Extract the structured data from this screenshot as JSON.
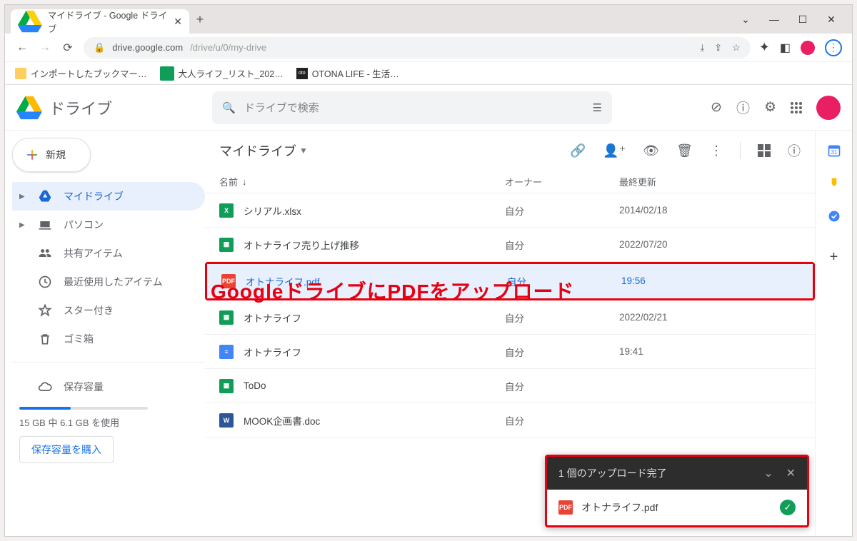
{
  "browser": {
    "tab_title": "マイドライブ - Google ドライブ",
    "url_host": "drive.google.com",
    "url_path": "/drive/u/0/my-drive",
    "bookmarks": [
      {
        "label": "インポートしたブックマー…",
        "type": "folder"
      },
      {
        "label": "大人ライフ_リスト_202…",
        "type": "sheet"
      },
      {
        "label": "OTONA LIFE - 生活…",
        "type": "site"
      }
    ]
  },
  "drive": {
    "app_name": "ドライブ",
    "search_placeholder": "ドライブで検索",
    "new_button": "新規",
    "sidebar": [
      {
        "key": "mydrive",
        "label": "マイドライブ",
        "icon": "drive",
        "chev": true,
        "active": true
      },
      {
        "key": "computers",
        "label": "パソコン",
        "icon": "devices",
        "chev": true
      },
      {
        "key": "shared",
        "label": "共有アイテム",
        "icon": "people"
      },
      {
        "key": "recent",
        "label": "最近使用したアイテム",
        "icon": "clock"
      },
      {
        "key": "starred",
        "label": "スター付き",
        "icon": "star"
      },
      {
        "key": "trash",
        "label": "ゴミ箱",
        "icon": "trash"
      }
    ],
    "storage": {
      "title": "保存容量",
      "usage": "15 GB 中 6.1 GB を使用",
      "buy": "保存容量を購入"
    },
    "breadcrumb": "マイドライブ",
    "columns": {
      "name": "名前",
      "owner": "オーナー",
      "modified": "最終更新"
    },
    "files": [
      {
        "name": "シリアル.xlsx",
        "type": "xlsx",
        "owner": "自分",
        "modified": "2014/02/18"
      },
      {
        "name": "オトナライフ売り上げ推移",
        "type": "sheet",
        "owner": "自分",
        "modified": "2022/07/20"
      },
      {
        "name": "オトナライフ.pdf",
        "type": "pdf",
        "owner": "自分",
        "modified": "19:56",
        "selected": true,
        "highlight": true
      },
      {
        "name": "オトナライフ",
        "type": "sheet",
        "owner": "自分",
        "modified": "2022/02/21"
      },
      {
        "name": "オトナライフ",
        "type": "doc",
        "owner": "自分",
        "modified": "19:41"
      },
      {
        "name": "ToDo",
        "type": "sheet",
        "owner": "自分",
        "modified": ""
      },
      {
        "name": "MOOK企画書.doc",
        "type": "word",
        "owner": "自分",
        "modified": ""
      }
    ],
    "upload_toast": {
      "title": "1 個のアップロード完了",
      "file": "オトナライフ.pdf"
    }
  },
  "annotation": "GoogleドライブにPDFをアップロード"
}
